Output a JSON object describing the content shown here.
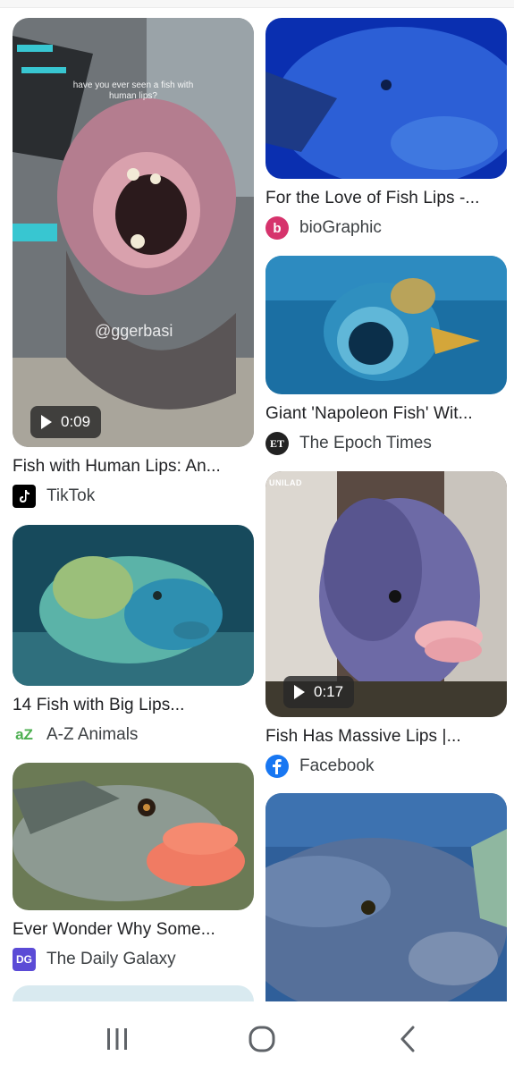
{
  "results": [
    {
      "title": "Fish with Human Lips: An...",
      "source": "TikTok",
      "source_icon": "tiktok-icon",
      "duration": "0:09",
      "overlay_text": "have you ever seen a fish with human lips?",
      "watermark": "@ggerbasi"
    },
    {
      "title": "For the Love of Fish Lips -...",
      "source": "bioGraphic",
      "source_icon": "biographic-icon",
      "icon_letter": "b",
      "icon_color": "#d6336c"
    },
    {
      "title": "Giant 'Napoleon Fish' Wit...",
      "source": "The Epoch Times",
      "source_icon": "epoch-times-icon",
      "icon_letter": "ET"
    },
    {
      "title": "14 Fish with Big Lips...",
      "source": "A-Z Animals",
      "source_icon": "az-animals-icon",
      "icon_letter": "aZ",
      "icon_color": "#4caf50"
    },
    {
      "title": "Fish Has Massive Lips |...",
      "source": "Facebook",
      "source_icon": "facebook-icon",
      "duration": "0:17",
      "watermark": "UNILAD",
      "icon_color": "#1877f2"
    },
    {
      "title": "Ever Wonder Why Some...",
      "source": "The Daily Galaxy",
      "source_icon": "daily-galaxy-icon",
      "icon_letter": "DG",
      "icon_color": "#5b4bd6"
    }
  ],
  "nav": {
    "recent": "recent-apps-icon",
    "home": "home-icon",
    "back": "back-icon"
  }
}
